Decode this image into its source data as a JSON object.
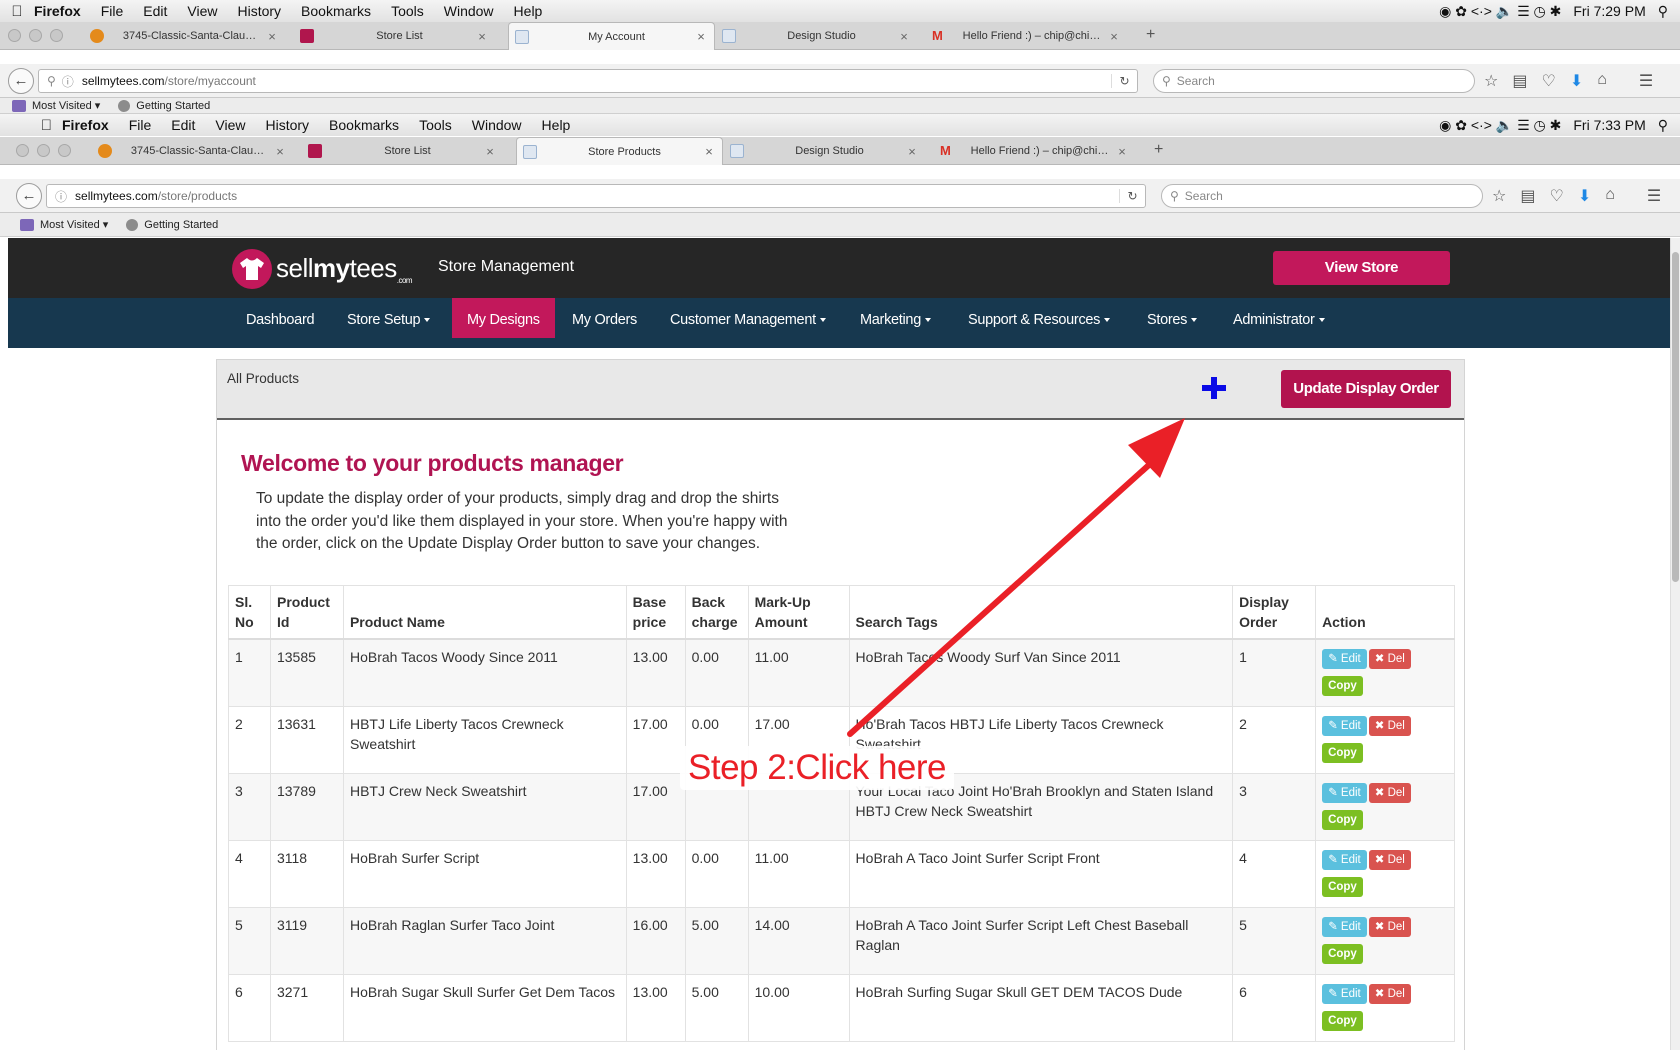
{
  "back_window": {
    "menubar": {
      "app": "Firefox",
      "items": [
        "File",
        "Edit",
        "View",
        "History",
        "Bookmarks",
        "Tools",
        "Window",
        "Help"
      ],
      "clock": "Fri 7:29 PM"
    },
    "tabs": [
      {
        "label": "3745-Classic-Santa-Clau…",
        "fav": "#e48a1b"
      },
      {
        "label": "Store List",
        "fav": "#b0164d"
      },
      {
        "label": "My Account",
        "fav": "#9bb3d0",
        "active": true
      },
      {
        "label": "Design Studio",
        "fav": "#9bb3d0"
      },
      {
        "label": "Hello Friend :) – chip@chi…",
        "fav": "#d93025"
      }
    ],
    "url": {
      "domain": "sellmytees.com",
      "path": "/store/myaccount"
    },
    "search_placeholder": "Search",
    "bookmarks": [
      "Most Visited",
      "Getting Started"
    ]
  },
  "front_window": {
    "menubar": {
      "app": "Firefox",
      "items": [
        "File",
        "Edit",
        "View",
        "History",
        "Bookmarks",
        "Tools",
        "Window",
        "Help"
      ],
      "clock": "Fri 7:33 PM"
    },
    "tabs": [
      {
        "label": "3745-Classic-Santa-Clau…",
        "fav": "#e48a1b"
      },
      {
        "label": "Store List",
        "fav": "#b0164d"
      },
      {
        "label": "Store Products",
        "fav": "#9bb3d0",
        "active": true
      },
      {
        "label": "Design Studio",
        "fav": "#9bb3d0"
      },
      {
        "label": "Hello Friend :) – chip@chi…",
        "fav": "#d93025"
      }
    ],
    "url": {
      "domain": "sellmytees.com",
      "path": "/store/products"
    },
    "search_placeholder": "Search",
    "bookmarks": [
      "Most Visited",
      "Getting Started"
    ]
  },
  "site": {
    "logo": {
      "part1": "sell",
      "part2": "my",
      "part3": "tees",
      "suffix": ".com"
    },
    "header_title": "Store Management",
    "view_store": "View Store",
    "nav": [
      "Dashboard",
      "Store Setup",
      "My Designs",
      "My Orders",
      "Customer Management",
      "Marketing",
      "Support & Resources",
      "Stores",
      "Administrator"
    ],
    "active_nav": "My Designs",
    "colors": {
      "brand": "#c2185b",
      "nav_bg": "#17384f",
      "header_bg": "#262626"
    }
  },
  "panel": {
    "title": "All Products",
    "update_button": "Update Display Order",
    "welcome": "Welcome to your products manager",
    "intro_lines": [
      "To update the display order of your products, simply drag and drop the shirts",
      "into the order you'd like them displayed in your store. When you're happy with",
      "the order, click on the Update Display Order button to save your changes."
    ]
  },
  "table": {
    "headers": [
      "Sl. No",
      "Product Id",
      "Product Name",
      "Base price",
      "Back charge",
      "Mark-Up Amount",
      "Search Tags",
      "Display Order",
      "Action"
    ],
    "header_lines": [
      [
        "Sl.",
        "No"
      ],
      [
        "Product",
        "Id"
      ],
      [
        "",
        "Product Name"
      ],
      [
        "Base",
        "price"
      ],
      [
        "Back",
        "charge"
      ],
      [
        "Mark-Up",
        "Amount"
      ],
      [
        "",
        "Search Tags"
      ],
      [
        "Display",
        "Order"
      ],
      [
        "",
        "Action"
      ]
    ],
    "actions": {
      "edit": "Edit",
      "del": "Del",
      "copy": "Copy"
    },
    "rows": [
      [
        "1",
        "13585",
        "HoBrah Tacos Woody Since 2011",
        "13.00",
        "0.00",
        "11.00",
        "HoBrah Tacos Woody Surf Van Since 2011",
        "1"
      ],
      [
        "2",
        "13631",
        "HBTJ Life Liberty Tacos Crewneck Sweatshirt",
        "17.00",
        "0.00",
        "17.00",
        "Ho'Brah Tacos HBTJ Life Liberty Tacos Crewneck Sweatshirt",
        "2"
      ],
      [
        "3",
        "13789",
        "HBTJ Crew Neck Sweatshirt",
        "17.00",
        "",
        "",
        "Your Local Taco Joint Ho'Brah Brooklyn and Staten Island HBTJ Crew Neck Sweatshirt",
        "3"
      ],
      [
        "4",
        "3118",
        "HoBrah Surfer Script",
        "13.00",
        "0.00",
        "11.00",
        "HoBrah A Taco Joint Surfer Script Front",
        "4"
      ],
      [
        "5",
        "3119",
        "HoBrah Raglan Surfer Taco Joint",
        "16.00",
        "5.00",
        "14.00",
        "HoBrah A Taco Joint Surfer Script Left Chest Baseball Raglan",
        "5"
      ],
      [
        "6",
        "3271",
        "HoBrah Sugar Skull Surfer Get Dem Tacos",
        "13.00",
        "5.00",
        "10.00",
        "HoBrah Surfing Sugar Skull GET DEM TACOS Dude",
        "6"
      ]
    ]
  },
  "annotation": {
    "label": "Step 2:Click here",
    "color": "#ea2027"
  }
}
